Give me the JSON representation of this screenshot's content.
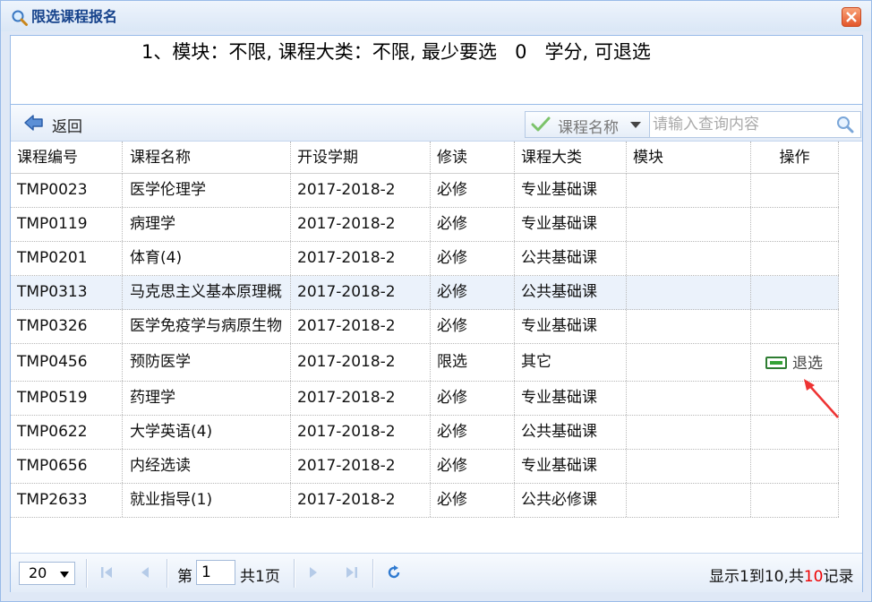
{
  "window": {
    "title": "限选课程报名"
  },
  "notice": {
    "text": "1、模块：不限, 课程大类：不限, 最少要选   0   学分, 可退选"
  },
  "toolbar": {
    "back_label": "返回",
    "search_field_label": "课程名称",
    "search_placeholder": "请输入查询内容"
  },
  "table": {
    "headers": [
      "课程编号",
      "课程名称",
      "开设学期",
      "修读",
      "课程大类",
      "模块",
      "操作"
    ],
    "rows": [
      {
        "code": "TMP0023",
        "name": "医学伦理学",
        "term": "2017-2018-2",
        "type": "必修",
        "category": "专业基础课",
        "module": "",
        "op": ""
      },
      {
        "code": "TMP0119",
        "name": "病理学",
        "term": "2017-2018-2",
        "type": "必修",
        "category": "专业基础课",
        "module": "",
        "op": ""
      },
      {
        "code": "TMP0201",
        "name": "体育(4)",
        "term": "2017-2018-2",
        "type": "必修",
        "category": "公共基础课",
        "module": "",
        "op": ""
      },
      {
        "code": "TMP0313",
        "name": "马克思主义基本原理概",
        "term": "2017-2018-2",
        "type": "必修",
        "category": "公共基础课",
        "module": "",
        "op": ""
      },
      {
        "code": "TMP0326",
        "name": "医学免疫学与病原生物",
        "term": "2017-2018-2",
        "type": "必修",
        "category": "专业基础课",
        "module": "",
        "op": ""
      },
      {
        "code": "TMP0456",
        "name": "预防医学",
        "term": "2017-2018-2",
        "type": "限选",
        "category": "其它",
        "module": "",
        "op": "退选"
      },
      {
        "code": "TMP0519",
        "name": "药理学",
        "term": "2017-2018-2",
        "type": "必修",
        "category": "专业基础课",
        "module": "",
        "op": ""
      },
      {
        "code": "TMP0622",
        "name": "大学英语(4)",
        "term": "2017-2018-2",
        "type": "必修",
        "category": "公共基础课",
        "module": "",
        "op": ""
      },
      {
        "code": "TMP0656",
        "name": "内经选读",
        "term": "2017-2018-2",
        "type": "必修",
        "category": "专业基础课",
        "module": "",
        "op": ""
      },
      {
        "code": "TMP2633",
        "name": "就业指导(1)",
        "term": "2017-2018-2",
        "type": "必修",
        "category": "公共必修课",
        "module": "",
        "op": ""
      }
    ]
  },
  "pager": {
    "page_size": "20",
    "page_prefix": "第",
    "page_value": "1",
    "page_total": "共1页",
    "info_before": "显示1到10,共",
    "info_count": "10",
    "info_after": "记录"
  },
  "colors": {
    "accent": "#15428b",
    "highlight_row": "#ebf2fb",
    "count_red": "#ee0000",
    "annotation_arrow": "#ee3333"
  }
}
